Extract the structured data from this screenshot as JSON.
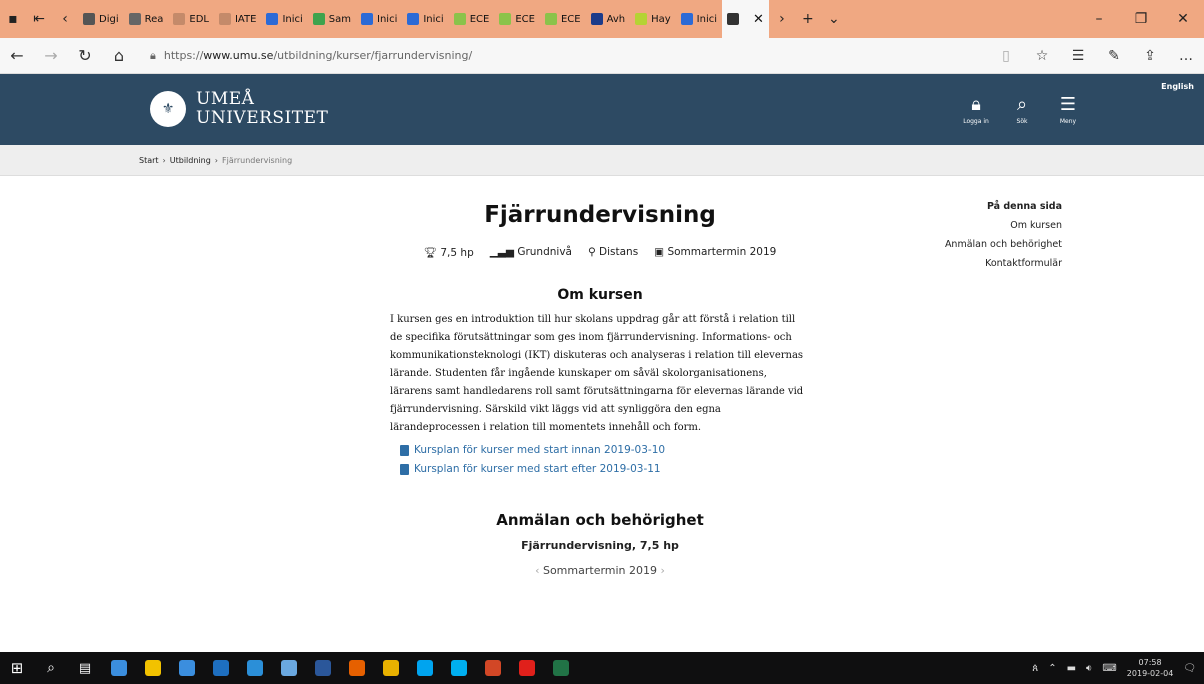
{
  "browser": {
    "tabs": [
      {
        "label": "Digi",
        "color": "#555555"
      },
      {
        "label": "Rea",
        "color": "#666666"
      },
      {
        "label": "EDL",
        "color": "#c48a6a"
      },
      {
        "label": "IATE",
        "color": "#c48a6a"
      },
      {
        "label": "Inici",
        "color": "#2c6ad6"
      },
      {
        "label": "Sam",
        "color": "#3fa34d"
      },
      {
        "label": "Inici",
        "color": "#2c6ad6"
      },
      {
        "label": "Inici",
        "color": "#2c6ad6"
      },
      {
        "label": "ECE",
        "color": "#8bc34a"
      },
      {
        "label": "ECE",
        "color": "#8bc34a"
      },
      {
        "label": "ECE",
        "color": "#8bc34a"
      },
      {
        "label": "Avh",
        "color": "#1b3b8a"
      },
      {
        "label": "Hay",
        "color": "#b5d334"
      },
      {
        "label": "Inici",
        "color": "#2c6ad6"
      }
    ],
    "url_prefix": "https://",
    "url_domain": "www.umu.se",
    "url_path": "/utbildning/kurser/fjarrundervisning/"
  },
  "site": {
    "logo_line1": "UMEÅ",
    "logo_line2": "UNIVERSITET",
    "login_label": "Logga in",
    "search_label": "Sök",
    "menu_label": "Meny",
    "language_link": "English"
  },
  "breadcrumb": [
    "Start",
    "Utbildning",
    "Fjärrundervisning"
  ],
  "course": {
    "title": "Fjärrundervisning",
    "credits": "7,5 hp",
    "level": "Grundnivå",
    "mode": "Distans",
    "term": "Sommartermin 2019",
    "about_heading": "Om kursen",
    "description": "I kursen ges en introduktion till hur skolans uppdrag går att förstå i relation till de specifika förutsättningar som ges inom fjärrundervisning. Informations- och kommunikationsteknologi (IKT) diskuteras och analyseras i relation till elevernas lärande. Studenten får ingående kunskaper om såväl skolorganisationens, lärarens samt handledarens roll samt förutsättningarna för elevernas lärande vid fjärrundervisning. Särskild vikt läggs vid att synliggöra den egna lärandeprocessen i relation till momentets innehåll och form.",
    "links": [
      "Kursplan för kurser med start innan 2019-03-10",
      "Kursplan för kurser med start efter 2019-03-11"
    ],
    "apply_heading": "Anmälan och behörighet",
    "apply_sub": "Fjärrundervisning, 7,5 hp",
    "term_nav": "Sommartermin 2019"
  },
  "sidebar": {
    "heading": "På denna sida",
    "items": [
      "Om kursen",
      "Anmälan och behörighet",
      "Kontaktformulär"
    ]
  },
  "taskbar": {
    "apps": [
      {
        "name": "edge-app",
        "color": "#3b8ede"
      },
      {
        "name": "explorer-app",
        "color": "#f2c200"
      },
      {
        "name": "store-app",
        "color": "#3b8ede"
      },
      {
        "name": "outlook-app",
        "color": "#1e6fc0"
      },
      {
        "name": "ie-app",
        "color": "#2b8fd8"
      },
      {
        "name": "globe-app",
        "color": "#6aa8e0"
      },
      {
        "name": "word-app",
        "color": "#2b579a"
      },
      {
        "name": "firefox-app",
        "color": "#e66000"
      },
      {
        "name": "chrome-app",
        "color": "#e8b100"
      },
      {
        "name": "skype-business-app",
        "color": "#00a4ef"
      },
      {
        "name": "skype-app",
        "color": "#00aff0"
      },
      {
        "name": "powerpoint-app",
        "color": "#d24726"
      },
      {
        "name": "acrobat-app",
        "color": "#e0201b"
      },
      {
        "name": "excel-app",
        "color": "#217346"
      }
    ],
    "time": "07:58",
    "date": "2019-02-04"
  }
}
